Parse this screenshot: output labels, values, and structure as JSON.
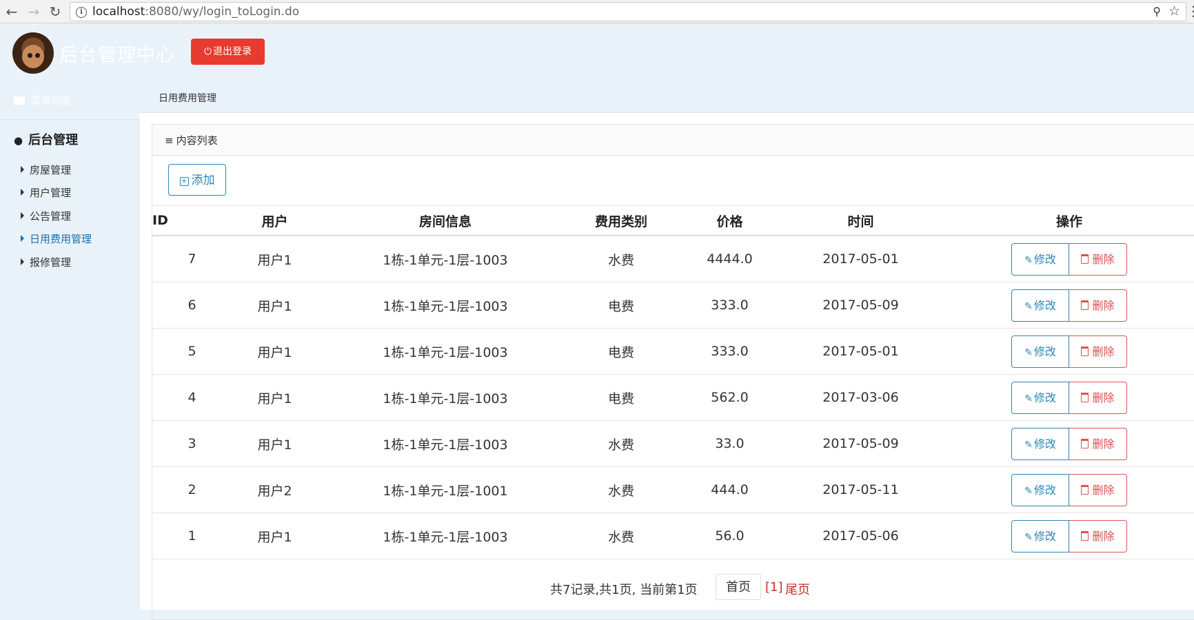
{
  "browser": {
    "url_host": "localhost",
    "url_path": ":8080/wy/login_toLogin.do"
  },
  "header": {
    "title": "后台管理中心",
    "logout_label": "退出登录"
  },
  "menu_list_label": "菜单列表",
  "breadcrumb": "日用费用管理",
  "sidebar": {
    "heading": "后台管理",
    "items": [
      {
        "label": "房屋管理"
      },
      {
        "label": "用户管理"
      },
      {
        "label": "公告管理"
      },
      {
        "label": "日用费用管理"
      },
      {
        "label": "报修管理"
      }
    ]
  },
  "panel": {
    "title": "内容列表",
    "add_label": "添加"
  },
  "table": {
    "headers": {
      "id": "ID",
      "user": "用户",
      "room": "房间信息",
      "type": "费用类别",
      "price": "价格",
      "time": "时间",
      "ops": "操作"
    },
    "edit_label": "修改",
    "delete_label": "删除",
    "rows": [
      {
        "id": "7",
        "user": "用户1",
        "room": "1栋-1单元-1层-1003",
        "type": "水费",
        "price": "4444.0",
        "time": "2017-05-01"
      },
      {
        "id": "6",
        "user": "用户1",
        "room": "1栋-1单元-1层-1003",
        "type": "电费",
        "price": "333.0",
        "time": "2017-05-09"
      },
      {
        "id": "5",
        "user": "用户1",
        "room": "1栋-1单元-1层-1003",
        "type": "电费",
        "price": "333.0",
        "time": "2017-05-01"
      },
      {
        "id": "4",
        "user": "用户1",
        "room": "1栋-1单元-1层-1003",
        "type": "电费",
        "price": "562.0",
        "time": "2017-03-06"
      },
      {
        "id": "3",
        "user": "用户1",
        "room": "1栋-1单元-1层-1003",
        "type": "水费",
        "price": "33.0",
        "time": "2017-05-09"
      },
      {
        "id": "2",
        "user": "用户2",
        "room": "1栋-1单元-1层-1001",
        "type": "水费",
        "price": "444.0",
        "time": "2017-05-11"
      },
      {
        "id": "1",
        "user": "用户1",
        "room": "1栋-1单元-1层-1003",
        "type": "水费",
        "price": "56.0",
        "time": "2017-05-06"
      }
    ]
  },
  "pager": {
    "summary": "共7记录,共1页, 当前第1页",
    "first_label": "首页",
    "current": "[1]",
    "last_label": "尾页"
  },
  "colors": {
    "primary": "#2a86b8",
    "danger": "#d9534f",
    "logout": "#e63b2e",
    "background": "#eaf2f9"
  }
}
